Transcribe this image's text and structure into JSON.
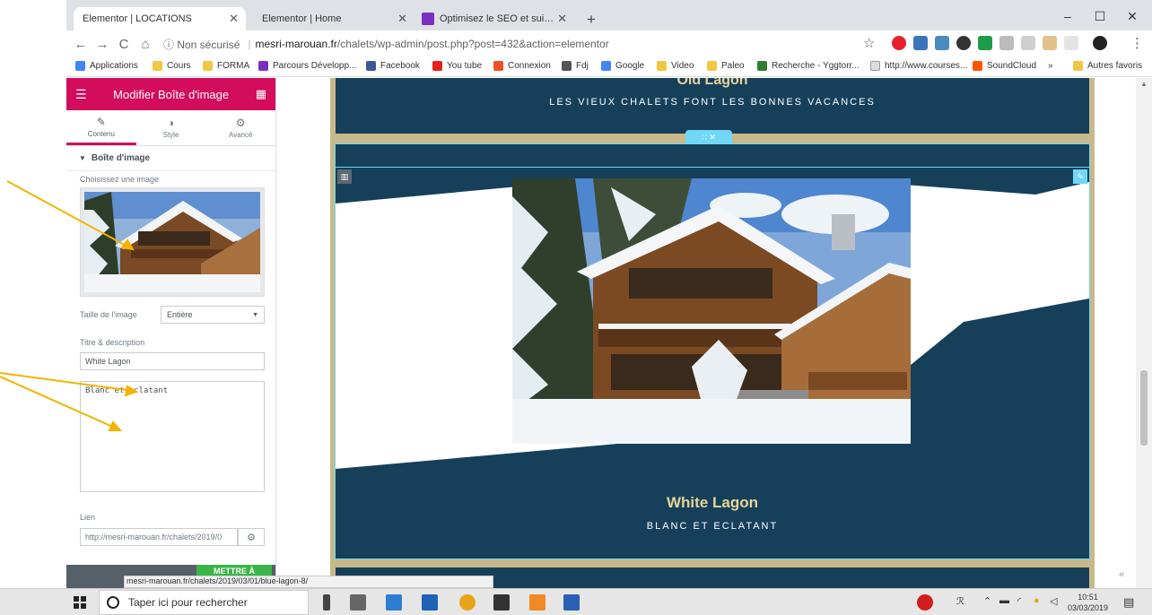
{
  "browser": {
    "tabs": [
      {
        "title": "Elementor | LOCATIONS",
        "active": true
      },
      {
        "title": "Elementor | Home",
        "active": false
      },
      {
        "title": "Optimisez le SEO et suivez le trafic",
        "active": false
      }
    ],
    "new_tab": "+",
    "window_controls": [
      "–",
      "☐",
      "✕"
    ],
    "nav": {
      "back": "←",
      "forward": "→",
      "reload": "C",
      "home": "⌂"
    },
    "omnibox": {
      "security": "ⓘ Non sécurisé",
      "separator": "|",
      "host": "mesri-marouan.fr",
      "path": "/chalets/wp-admin/post.php?post=432&action=elementor"
    },
    "star": "☆",
    "menu": "⋮",
    "bookmarks": [
      {
        "label": "Applications",
        "icon": "apps-grid-icon"
      },
      {
        "label": "Cours",
        "icon": "folder-icon"
      },
      {
        "label": "FORMA",
        "icon": "folder-icon"
      },
      {
        "label": "Parcours Développ...",
        "icon": "openclassrooms-icon"
      },
      {
        "label": "Facebook",
        "icon": "facebook-icon"
      },
      {
        "label": "You tube",
        "icon": "youtube-icon"
      },
      {
        "label": "Connexion",
        "icon": "microsoft-icon"
      },
      {
        "label": "Fdj",
        "icon": "fdj-icon"
      },
      {
        "label": "Google",
        "icon": "google-icon"
      },
      {
        "label": "Video",
        "icon": "folder-icon"
      },
      {
        "label": "Paleo",
        "icon": "folder-icon"
      },
      {
        "label": "Recherche - Yggtorr...",
        "icon": "ygg-icon"
      },
      {
        "label": "http://www.courses...",
        "icon": "page-icon"
      },
      {
        "label": "SoundCloud",
        "icon": "soundcloud-icon"
      },
      {
        "label": "»",
        "icon": ""
      },
      {
        "label": "Autres favoris",
        "icon": "folder-icon"
      }
    ],
    "status_url": "mesri-marouan.fr/chalets/2019/03/01/blue-lagon-8/"
  },
  "panel": {
    "header_title": "Modifier Boîte d'image",
    "tabs": [
      {
        "label": "Contenu",
        "icon": "✎"
      },
      {
        "label": "Style",
        "icon": "◑"
      },
      {
        "label": "Avancé",
        "icon": "⚙"
      }
    ],
    "section_title": "Boîte d'image",
    "choose_image_label": "Choisissez une image",
    "image_size_label": "Taille de l'image",
    "image_size_value": "Entière",
    "title_desc_label": "Titre & description",
    "title_value": "White Lagon",
    "description_value": "Blanc et eclatant",
    "link_label": "Lien",
    "link_value": "http://mesri-marouan.fr/chalets/2019/0",
    "publish_label": "METTRE À",
    "collapse": "‹"
  },
  "preview": {
    "prev_title": "Old Lagon",
    "prev_tagline": "LES VIEUX CHALETS FONT LES BONNES VACANCES",
    "section_handle": "∷  ✕",
    "caption_title": "White Lagon",
    "caption_desc": "BLANC ET ECLATANT",
    "back_to_top": "«"
  },
  "taskbar": {
    "search_placeholder": "Taper ici pour rechercher",
    "time": "10:51",
    "date": "03/03/2019"
  },
  "colors": {
    "elementor_pink": "#d30c5c",
    "site_navy": "#16405a",
    "gold": "#e8d49a",
    "publish_green": "#39b54a",
    "edit_cyan": "#71d7f7"
  }
}
